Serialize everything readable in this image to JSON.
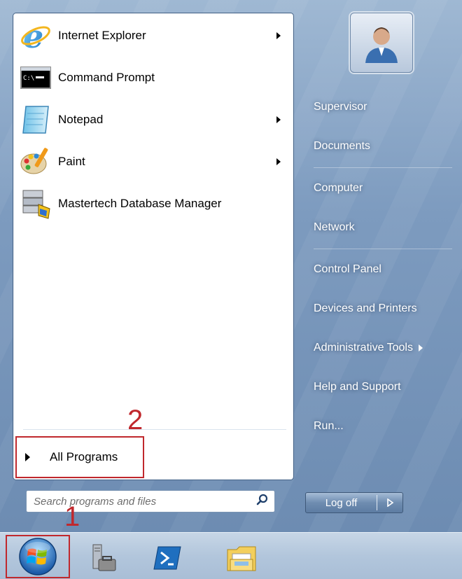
{
  "programs": [
    {
      "label": "Internet Explorer",
      "icon": "internet-explorer-icon",
      "has_submenu": true
    },
    {
      "label": "Command Prompt",
      "icon": "command-prompt-icon",
      "has_submenu": false
    },
    {
      "label": "Notepad",
      "icon": "notepad-icon",
      "has_submenu": true
    },
    {
      "label": "Paint",
      "icon": "paint-icon",
      "has_submenu": true
    },
    {
      "label": "Mastertech Database Manager",
      "icon": "database-manager-icon",
      "has_submenu": false
    }
  ],
  "all_programs_label": "All Programs",
  "search": {
    "placeholder": "Search programs and files",
    "value": ""
  },
  "right_items": {
    "supervisor": "Supervisor",
    "documents": "Documents",
    "computer": "Computer",
    "network": "Network",
    "control_panel": "Control Panel",
    "devices": "Devices and Printers",
    "admin_tools": "Administrative Tools",
    "help": "Help and Support",
    "run": "Run..."
  },
  "logoff_label": "Log off",
  "annotations": {
    "one": "1",
    "two": "2"
  },
  "colors": {
    "annotation": "#c0282d"
  },
  "taskbar_icons": [
    "server-manager-icon",
    "powershell-icon",
    "explorer-folder-icon"
  ]
}
